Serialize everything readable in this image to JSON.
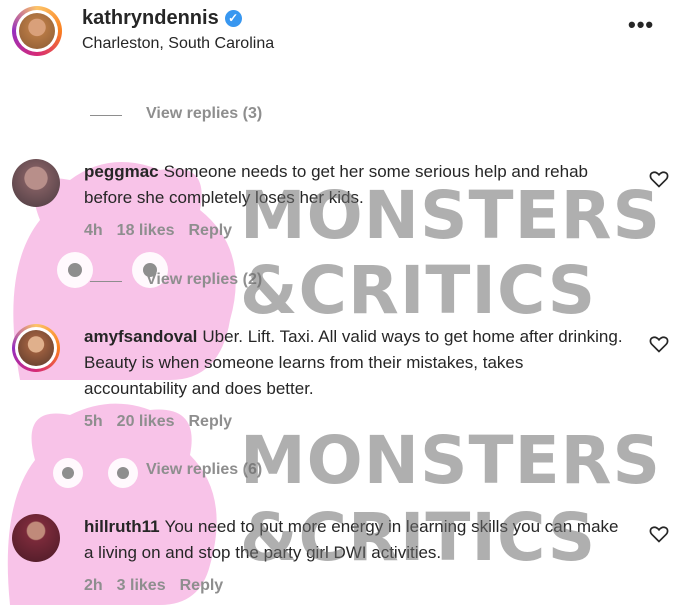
{
  "post_header": {
    "username": "kathryndennis",
    "verified": true,
    "location": "Charleston, South Carolina",
    "more_icon": "more-horizontal-icon"
  },
  "view_replies": [
    {
      "label": "View replies (3)"
    },
    {
      "label": "View replies (2)"
    },
    {
      "label": "View replies (6)"
    }
  ],
  "comments": [
    {
      "username": "peggmac",
      "text": "Someone needs to get her some serious help and rehab before she completely loses her kids.",
      "time": "4h",
      "likes": "18 likes",
      "reply": "Reply"
    },
    {
      "username": "amyfsandoval",
      "text": "Uber. Lift. Taxi. All valid ways to get home after drinking. Beauty is when someone learns from their mistakes, takes accountability and does better.",
      "time": "5h",
      "likes": "20 likes",
      "reply": "Reply"
    },
    {
      "username": "hillruth11",
      "text": "You need to put more energy in learning skills you can make a living on and stop the party girl DWI activities.",
      "time": "2h",
      "likes": "3 likes",
      "reply": "Reply"
    }
  ],
  "watermark": {
    "line1": "MONSTERS",
    "line2": "&CRITICS"
  },
  "colors": {
    "muted": "#8e8e8e",
    "verified": "#3897f0",
    "watermark_mascot": "#f7b8e4"
  }
}
